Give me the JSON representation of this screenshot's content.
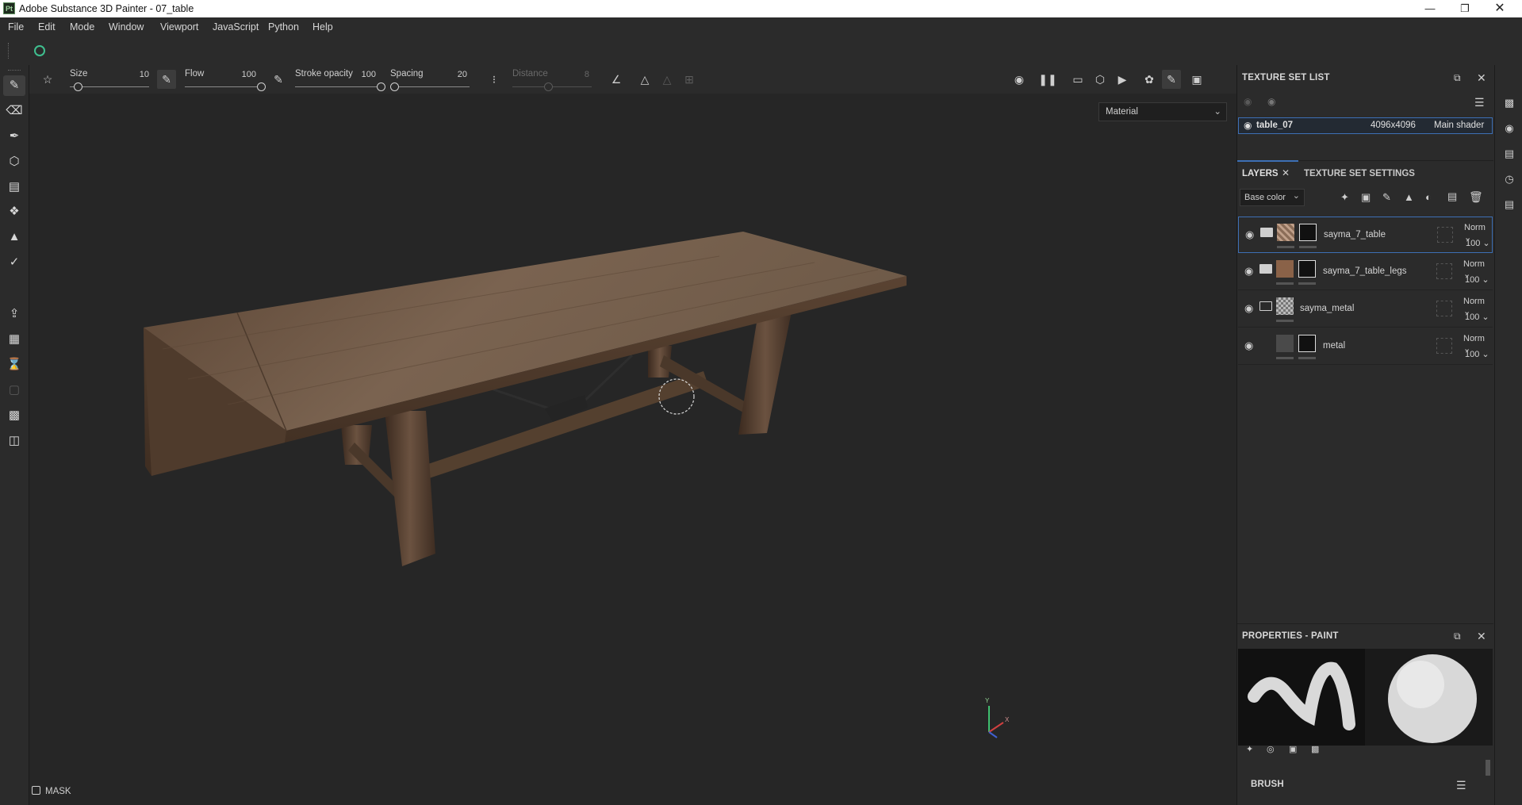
{
  "window": {
    "app_icon": "Pt",
    "title": "Adobe Substance 3D Painter - 07_table",
    "controls": [
      "minimize-icon",
      "maximize-icon",
      "close-icon"
    ]
  },
  "menu": [
    "File",
    "Edit",
    "Mode",
    "Window",
    "Viewport",
    "JavaScript",
    "Python",
    "Help"
  ],
  "tool_options": {
    "size": {
      "label": "Size",
      "value": "10",
      "fraction": 0.1
    },
    "flow": {
      "label": "Flow",
      "value": "100",
      "fraction": 1.0
    },
    "stroke_opacity": {
      "label": "Stroke opacity",
      "value": "100",
      "fraction": 1.0
    },
    "spacing": {
      "label": "Spacing",
      "value": "20",
      "fraction": 0.05
    },
    "distance": {
      "label": "Distance",
      "value": "8",
      "fraction": 0.45
    }
  },
  "viewport": {
    "material_mode": "Material",
    "mask_label": "MASK",
    "axis_labels": {
      "y": "Y",
      "x": "X"
    }
  },
  "texture_set_list": {
    "title": "TEXTURE SET LIST",
    "item": {
      "name": "table_07",
      "resolution": "4096x4096",
      "shader": "Main shader"
    }
  },
  "layers_panel": {
    "tabs": [
      {
        "label": "LAYERS",
        "active": true
      },
      {
        "label": "TEXTURE SET SETTINGS",
        "active": false
      }
    ],
    "channel": "Base color",
    "layers": [
      {
        "name": "sayma_7_table",
        "blend": "Norm",
        "opacity": "100",
        "selected": true
      },
      {
        "name": "sayma_7_table_legs",
        "blend": "Norm",
        "opacity": "100",
        "selected": false
      },
      {
        "name": "sayma_metal",
        "blend": "Norm",
        "opacity": "100",
        "selected": false
      },
      {
        "name": "metal",
        "blend": "Norm",
        "opacity": "100",
        "selected": false
      }
    ]
  },
  "properties": {
    "title": "PROPERTIES - PAINT",
    "brush_label": "BRUSH"
  },
  "colors": {
    "accent_blue": "#3d6fb5",
    "panel_bg": "#2b2b2b",
    "viewport_bg": "#262626",
    "wood": "#6b5340"
  }
}
